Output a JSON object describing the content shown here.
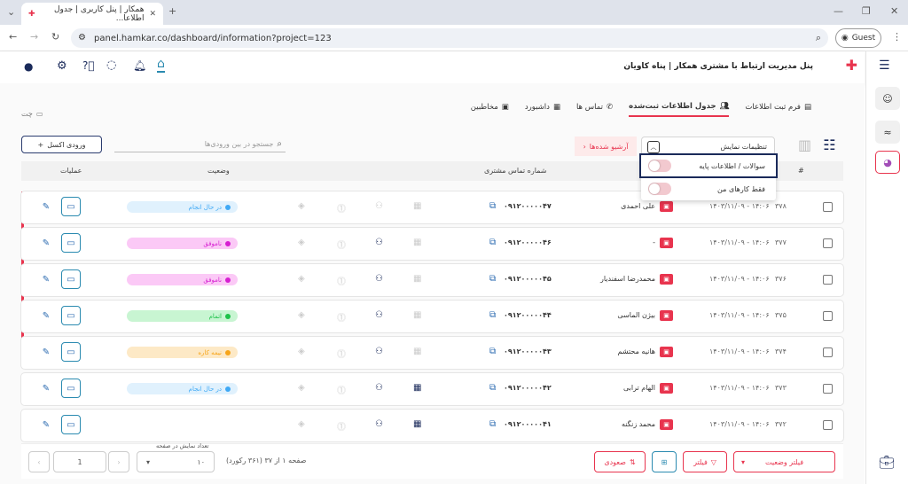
{
  "browser": {
    "tab_title": "همکار | پنل کاربری | جدول اطلاعا...",
    "url": "panel.hamkar.co/dashboard/information?project=123",
    "guest_label": "Guest"
  },
  "header": {
    "title": "پنل مدیریت ارتباط با مشتری همکار | پناه کاویان"
  },
  "tabs": [
    {
      "label": "فرم ثبت اطلاعات"
    },
    {
      "label": "جدول اطلاعات ثبت‌شده"
    },
    {
      "label": "تماس ها"
    },
    {
      "label": "داشبورد"
    },
    {
      "label": "مخاطبین"
    }
  ],
  "chat_label": "چت",
  "toolbar": {
    "excel_label": "ورودی اکسل",
    "search_placeholder": "جستجو در بین ورودی‌ها",
    "display_settings_label": "تنظیمات نمایش",
    "archive_label": "آرشیو شده‌ها"
  },
  "dropdown": {
    "items": [
      {
        "label": "سوالات / اطلاعات پایه"
      },
      {
        "label": "فقط کارهای من"
      }
    ]
  },
  "table": {
    "headers": {
      "num": "#",
      "phone": "شماره تماس مشتری",
      "status": "وضعیت",
      "actions": "عملیات"
    },
    "rows": [
      {
        "num": "۳۷۸",
        "date": "۱۴۰۳/۱۱/۰۹ - ۱۴:۰۶",
        "name": "علی احمدی",
        "phone": "۰۹۱۲۰۰۰۰۰۴۷",
        "status": "در حال انجام",
        "status_color": "#3fa9f5",
        "status_bg": "#e0f1fd"
      },
      {
        "num": "۳۷۷",
        "date": "۱۴۰۳/۱۱/۰۹ - ۱۴:۰۶",
        "name": "-",
        "phone": "۰۹۱۲۰۰۰۰۰۴۶",
        "status": "ناموفق",
        "status_color": "#d61fd1",
        "status_bg": "#fbc9f6"
      },
      {
        "num": "۳۷۶",
        "date": "۱۴۰۳/۱۱/۰۹ - ۱۴:۰۶",
        "name": "محمدرضا اسفندیار",
        "phone": "۰۹۱۲۰۰۰۰۰۴۵",
        "status": "ناموفق",
        "status_color": "#d61fd1",
        "status_bg": "#fbc9f6"
      },
      {
        "num": "۳۷۵",
        "date": "۱۴۰۳/۱۱/۰۹ - ۱۴:۰۶",
        "name": "بیژن الماسی",
        "phone": "۰۹۱۲۰۰۰۰۰۴۴",
        "status": "اتمام",
        "status_color": "#1ec24a",
        "status_bg": "#c8f5d2"
      },
      {
        "num": "۳۷۴",
        "date": "۱۴۰۳/۱۱/۰۹ - ۱۴:۰۶",
        "name": "هانیه محتشم",
        "phone": "۰۹۱۲۰۰۰۰۰۴۳",
        "status": "نیمه کاره",
        "status_color": "#f7a51a",
        "status_bg": "#fde9c6"
      },
      {
        "num": "۳۷۳",
        "date": "۱۴۰۳/۱۱/۰۹ - ۱۴:۰۶",
        "name": "الهام ترابی",
        "phone": "۰۹۱۲۰۰۰۰۰۴۲",
        "status": "در حال انجام",
        "status_color": "#3fa9f5",
        "status_bg": "#e0f1fd"
      },
      {
        "num": "۳۷۲",
        "date": "۱۴۰۳/۱۱/۰۹ - ۱۴:۰۶",
        "name": "محمد زنگنه",
        "phone": "۰۹۱۲۰۰۰۰۰۴۱",
        "status": "",
        "status_color": "#3fa9f5",
        "status_bg": "#ffffff"
      }
    ]
  },
  "footer": {
    "status_filter_label": "فیلتر وضعیت",
    "filter_label": "فیلتر",
    "sort_label": "صعودی",
    "page_info": "صفحه ۱ از ۳۷ (۳۶۱ رکورد)",
    "per_page_caption": "تعداد نمایش در صفحه",
    "per_page_value": "۱۰",
    "page_input_value": "1"
  },
  "colors": {
    "accent": "#e8344e",
    "navy": "#1a2a5a"
  }
}
